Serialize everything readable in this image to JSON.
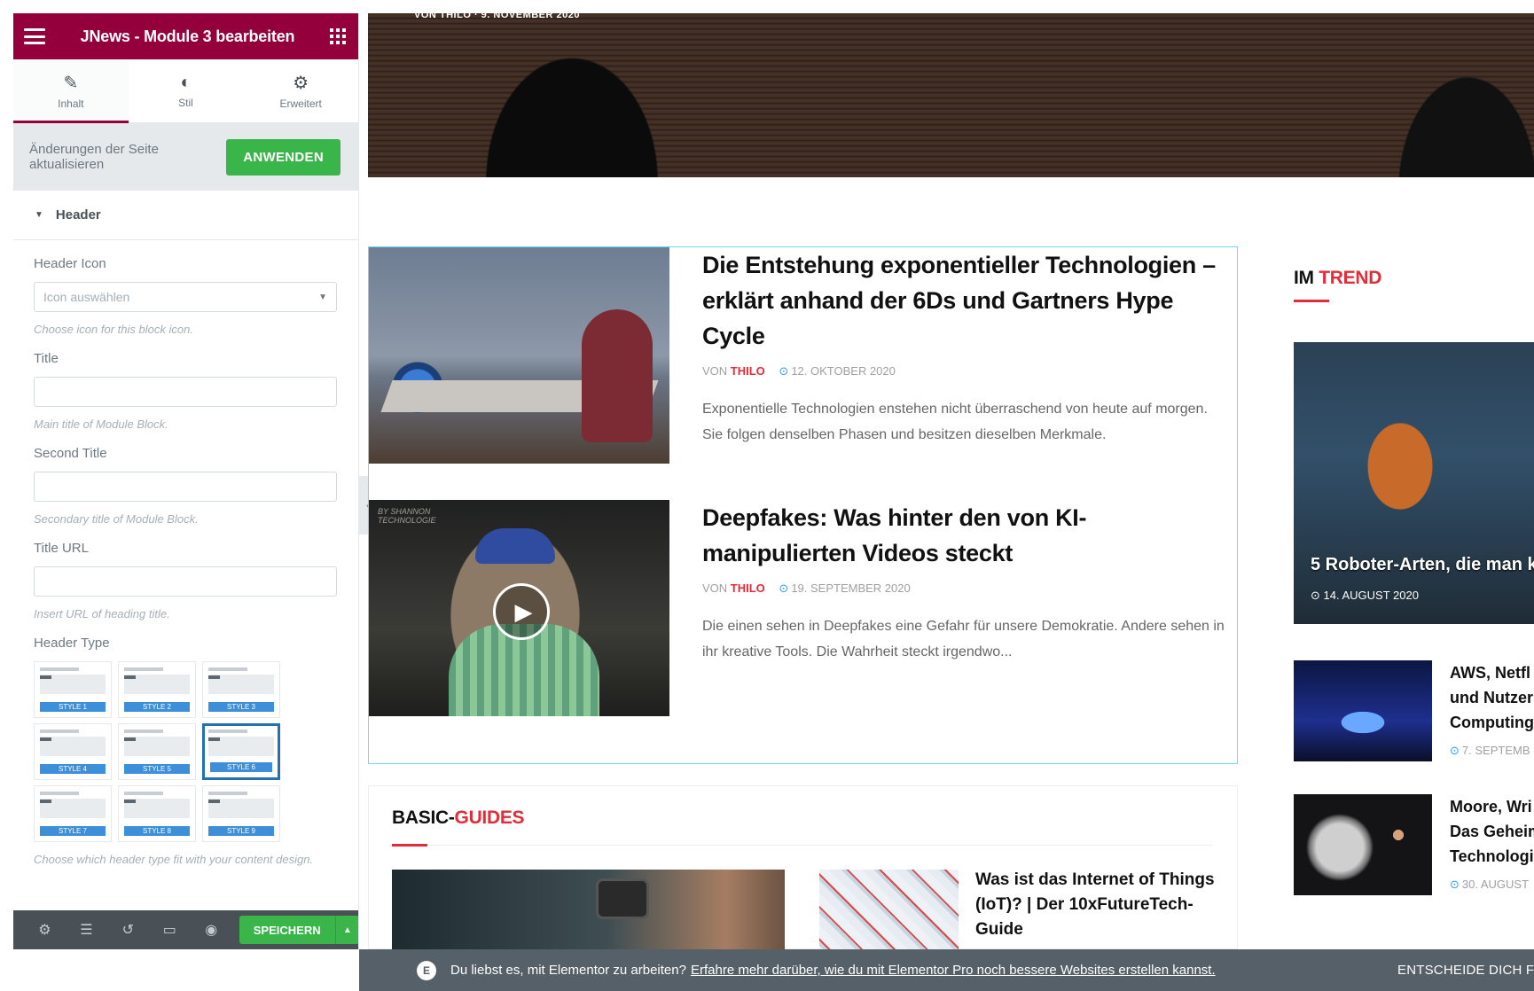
{
  "editor": {
    "header": {
      "title": "JNews - Module 3 bearbeiten",
      "menu_icon": "hamburger-icon",
      "widgets_icon": "grid-icon"
    },
    "tabs": [
      {
        "label": "Inhalt",
        "icon": "pencil-icon",
        "active": true
      },
      {
        "label": "Stil",
        "icon": "half-circle-icon",
        "active": false
      },
      {
        "label": "Erweitert",
        "icon": "gear-icon",
        "active": false
      }
    ],
    "apply_bar": {
      "text": "Änderungen der Seite aktualisieren",
      "button": "ANWENDEN"
    },
    "section": {
      "title": "Header"
    },
    "controls": {
      "header_icon": {
        "label": "Header Icon",
        "placeholder": "Icon auswählen",
        "hint": "Choose icon for this block icon."
      },
      "title": {
        "label": "Title",
        "value": "",
        "hint": "Main title of Module Block."
      },
      "second_title": {
        "label": "Second Title",
        "value": "",
        "hint": "Secondary title of Module Block."
      },
      "title_url": {
        "label": "Title URL",
        "value": "",
        "hint": "Insert URL of heading title."
      },
      "header_type": {
        "label": "Header Type",
        "options": [
          "STYLE 1",
          "STYLE 2",
          "STYLE 3",
          "STYLE 4",
          "STYLE 5",
          "STYLE 6",
          "STYLE 7",
          "STYLE 8",
          "STYLE 9"
        ],
        "selected": "STYLE 6",
        "hint": "Choose which header type fit with your content design."
      }
    },
    "footer": {
      "icons": [
        "gear-icon",
        "layers-icon",
        "history-icon",
        "responsive-icon",
        "eye-icon"
      ],
      "save_label": "SPEICHERN"
    }
  },
  "preview": {
    "hero_meta": "VON THILO · 9. NOVEMBER 2020",
    "posts": [
      {
        "title": "Die Entstehung exponentieller Technologien – erklärt anhand der 6Ds und Gartners Hype Cycle",
        "by": "VON",
        "author": "THILO",
        "date": "12. OKTOBER 2020",
        "excerpt": "Exponentielle Technologien enstehen nicht überraschend von heute auf morgen. Sie folgen denselben Phasen und besitzen dieselben Merkmale."
      },
      {
        "title": "Deepfakes: Was hinter den von KI-manipulierten Videos steckt",
        "by": "VON",
        "author": "THILO",
        "date": "19. SEPTEMBER 2020",
        "excerpt": "Die einen sehen in Deepfakes eine Gefahr für unsere Demokratie. Andere sehen in ihr kreative Tools. Die Wahrheit steckt irgendwo...",
        "watermark": "BY SHANNON\nTECHNOLOGIE"
      }
    ],
    "guides": {
      "title_plain": "BASIC-",
      "title_accent": "GUIDES",
      "side_title": "Was ist das Internet of Things (IoT)? | Der 10xFutureTech-Guide"
    },
    "trend": {
      "title_plain": "IM ",
      "title_accent": "TREND",
      "big": {
        "caption": "5 Roboter-Arten, die man k",
        "date": "14. AUGUST 2020"
      },
      "items": [
        {
          "title_lines": [
            "AWS, Netfl",
            "und Nutzer",
            "Computing"
          ],
          "date": "7. SEPTEMB"
        },
        {
          "title_lines": [
            "Moore, Wri",
            "Das Geheim",
            "Technologi"
          ],
          "date": "30. AUGUST"
        }
      ]
    }
  },
  "notice": {
    "text": "Du liebst es, mit Elementor zu arbeiten?",
    "link": "Erfahre mehr darüber, wie du mit Elementor Pro noch bessere Websites erstellen kannst.",
    "cta": "ENTSCHEIDE DICH F"
  }
}
